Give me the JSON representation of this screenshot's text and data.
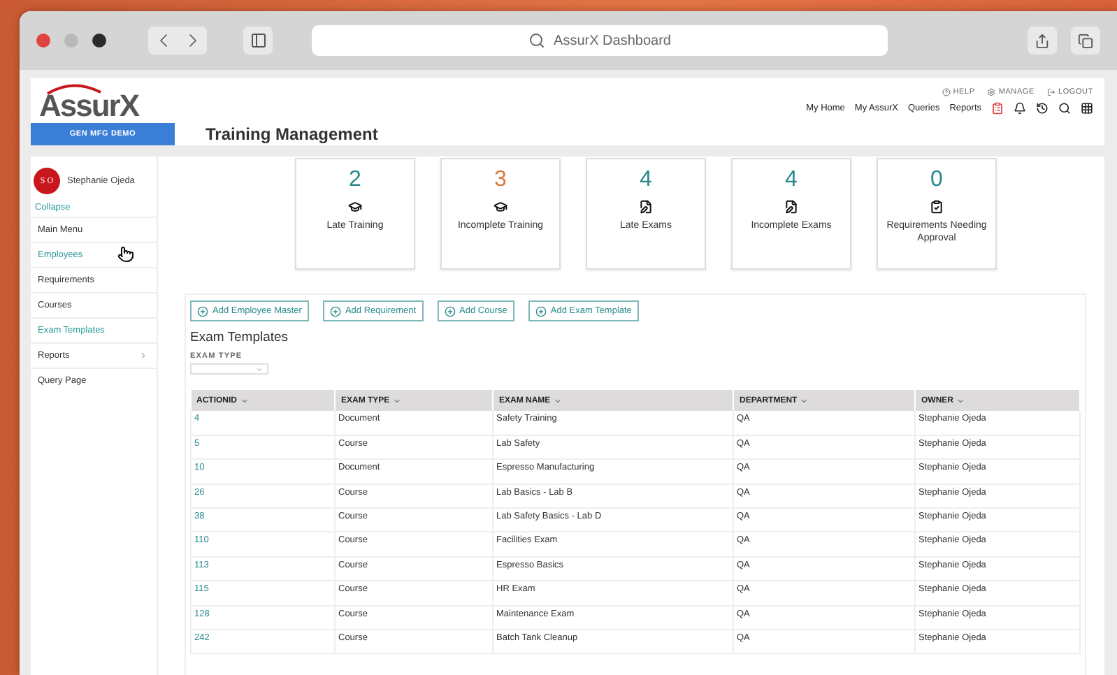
{
  "browser": {
    "address": "AssurX Dashboard"
  },
  "header": {
    "logo": "AssurX",
    "utility_links": [
      {
        "label": "HELP",
        "kind": "help"
      },
      {
        "label": "MANAGE",
        "kind": "manage"
      },
      {
        "label": "LOGOUT",
        "kind": "logout"
      }
    ],
    "nav": [
      "My Home",
      "My AssurX",
      "Queries",
      "Reports"
    ],
    "nav_icons": [
      {
        "kind": "clipboard",
        "alert": true
      },
      {
        "kind": "bell",
        "alert": false
      },
      {
        "kind": "history",
        "alert": false
      },
      {
        "kind": "search",
        "alert": false
      },
      {
        "kind": "apps",
        "alert": false
      }
    ]
  },
  "site_badge": "GEN MFG DEMO",
  "page_title": "Training Management",
  "sidebar": {
    "user": {
      "initials": "S O",
      "name": "Stephanie Ojeda"
    },
    "collapse": "Collapse",
    "items": [
      {
        "label": "Main Menu",
        "active": false,
        "expandable": false
      },
      {
        "label": "Employees",
        "active": true,
        "expandable": false,
        "pointer": true
      },
      {
        "label": "Requirements",
        "active": false,
        "expandable": false
      },
      {
        "label": "Courses",
        "active": false,
        "expandable": false
      },
      {
        "label": "Exam Templates",
        "active": true,
        "expandable": false
      },
      {
        "label": "Reports",
        "active": false,
        "expandable": true
      },
      {
        "label": "Query Page",
        "active": false,
        "expandable": false
      }
    ]
  },
  "cards": [
    {
      "count": "2",
      "label": "Late Training",
      "kind": "training",
      "color": "#2a8a8c"
    },
    {
      "count": "3",
      "label": "Incomplete Training",
      "kind": "training",
      "color": "#d9793a"
    },
    {
      "count": "4",
      "label": "Late Exams",
      "kind": "exam",
      "color": "#2a8a8c"
    },
    {
      "count": "4",
      "label": "Incomplete Exams",
      "kind": "exam",
      "color": "#2a8a8c"
    },
    {
      "count": "0",
      "label": "Requirements Needing Approval",
      "kind": "approval",
      "color": "#2a8a8c"
    }
  ],
  "actions": [
    "Add Employee Master",
    "Add Requirement",
    "Add Course",
    "Add Exam Template"
  ],
  "section_title": "Exam Templates",
  "filter": {
    "label": "EXAM TYPE"
  },
  "table": {
    "columns": [
      "ACTIONID",
      "EXAM TYPE",
      "EXAM NAME",
      "DEPARTMENT",
      "OWNER"
    ],
    "rows": [
      [
        "4",
        "Document",
        "Safety Training",
        "QA",
        "Stephanie Ojeda"
      ],
      [
        "5",
        "Course",
        "Lab Safety",
        "QA",
        "Stephanie Ojeda"
      ],
      [
        "10",
        "Document",
        "Espresso Manufacturing",
        "QA",
        "Stephanie Ojeda"
      ],
      [
        "26",
        "Course",
        "Lab Basics - Lab B",
        "QA",
        "Stephanie Ojeda"
      ],
      [
        "38",
        "Course",
        "Lab Safety Basics - Lab D",
        "QA",
        "Stephanie Ojeda"
      ],
      [
        "110",
        "Course",
        "Facilities Exam",
        "QA",
        "Stephanie Ojeda"
      ],
      [
        "113",
        "Course",
        "Espresso Basics",
        "QA",
        "Stephanie Ojeda"
      ],
      [
        "115",
        "Course",
        "HR Exam",
        "QA",
        "Stephanie Ojeda"
      ],
      [
        "128",
        "Course",
        "Maintenance Exam",
        "QA",
        "Stephanie Ojeda"
      ],
      [
        "242",
        "Course",
        "Batch Tank Cleanup",
        "QA",
        "Stephanie Ojeda"
      ]
    ]
  }
}
